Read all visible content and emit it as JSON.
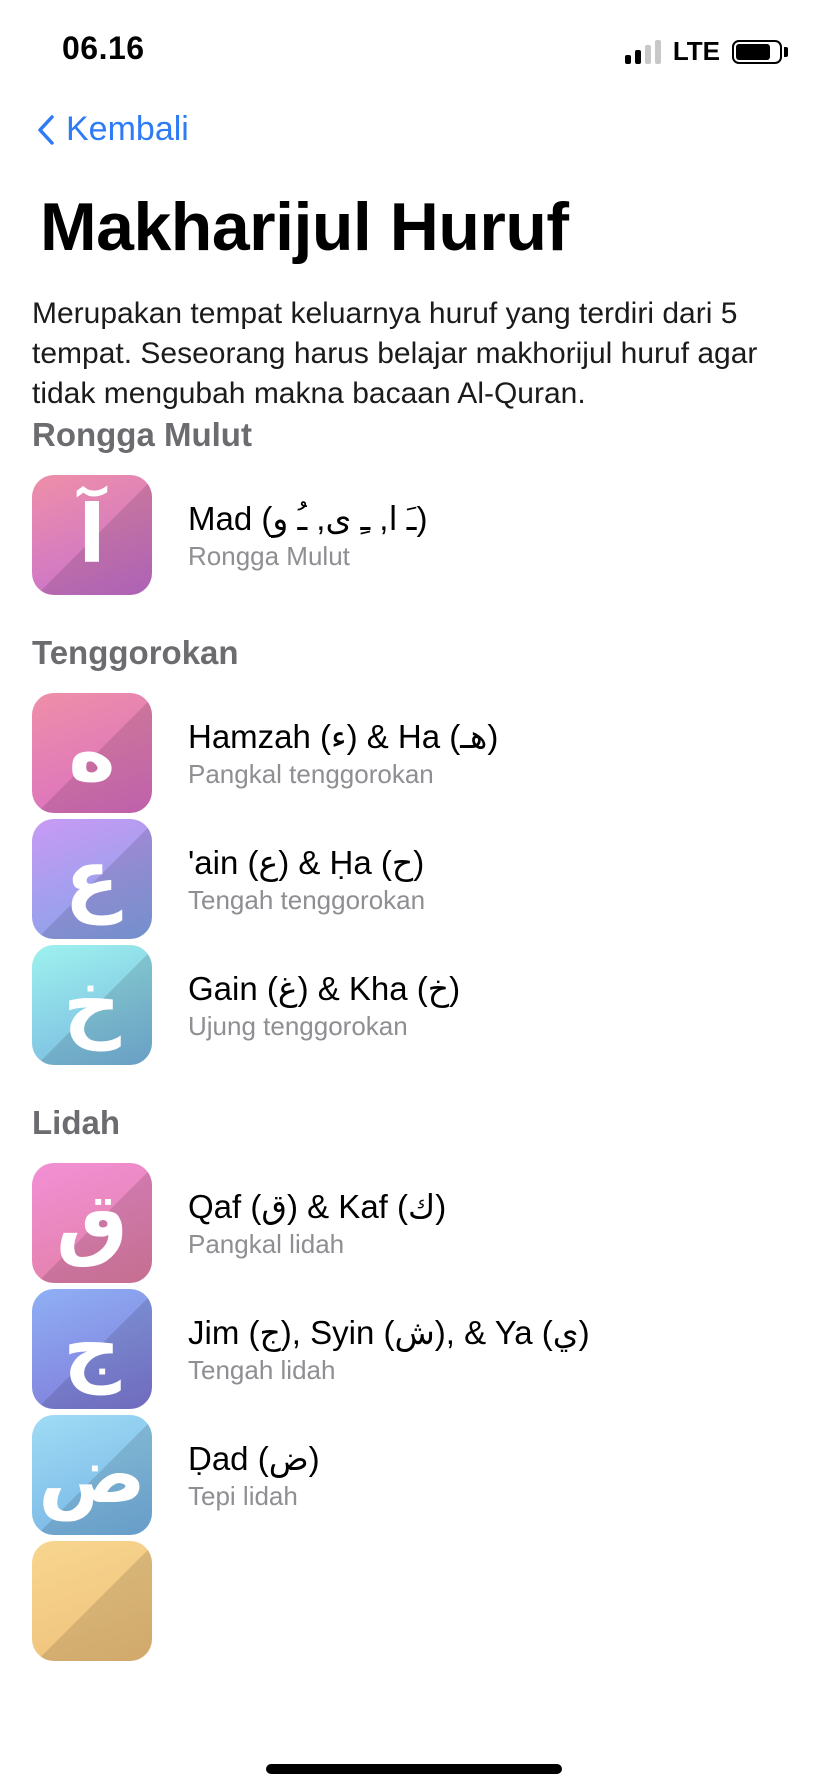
{
  "status_bar": {
    "time": "06.16",
    "network": "LTE"
  },
  "nav": {
    "back_label": "Kembali"
  },
  "page": {
    "title": "Makharijul Huruf",
    "description": "Merupakan tempat keluarnya huruf yang terdiri dari 5 tempat. Seseorang harus belajar makhorijul huruf agar tidak mengubah makna bacaan Al-Quran."
  },
  "sections": [
    {
      "header": "Rongga Mulut",
      "items": [
        {
          "glyph": "آ",
          "title": "Mad (ـَ ا, ـِ ى, ـُ و)",
          "subtitle": "Rongga Mulut",
          "gradient": [
            "#ef8fa8",
            "#c56fd0"
          ]
        }
      ]
    },
    {
      "header": "Tenggorokan",
      "items": [
        {
          "glyph": "ه",
          "title": "Hamzah (ء) & Ha (هـ)",
          "subtitle": "Pangkal tenggorokan",
          "gradient": [
            "#ef8fa8",
            "#d96ec3"
          ]
        },
        {
          "glyph": "ع",
          "title": "'ain (ع) & Ḥa (ح)",
          "subtitle": "Tengah tenggorokan",
          "gradient": [
            "#c99af5",
            "#82a3e8"
          ]
        },
        {
          "glyph": "خ",
          "title": "Gain (غ) & Kha (خ)",
          "subtitle": "Ujung tenggorokan",
          "gradient": [
            "#9ef2ee",
            "#77b5e0"
          ]
        }
      ]
    },
    {
      "header": "Lidah",
      "items": [
        {
          "glyph": "ق",
          "title": "Qaf (ق) & Kaf (ك)",
          "subtitle": "Pangkal lidah",
          "gradient": [
            "#f290d6",
            "#e07ea4"
          ]
        },
        {
          "glyph": "ج",
          "title": "Jim (ج), Syin (ش), & Ya (ي)",
          "subtitle": "Tengah lidah",
          "gradient": [
            "#8fb0f5",
            "#7f78d8"
          ]
        },
        {
          "glyph": "ض",
          "title": "Ḍad (ض)",
          "subtitle": "Tepi lidah",
          "gradient": [
            "#9fdcf5",
            "#74b2e4"
          ]
        }
      ]
    }
  ],
  "colors": {
    "accent": "#2f7bf5",
    "section_header": "#6b6b70",
    "subtitle": "#8e8e93",
    "partial_item_gradient": [
      "#f8d68f",
      "#eec07a"
    ]
  },
  "icons": {
    "back": "chevron-left-icon",
    "signal": "cellular-signal-icon",
    "battery": "battery-icon"
  }
}
